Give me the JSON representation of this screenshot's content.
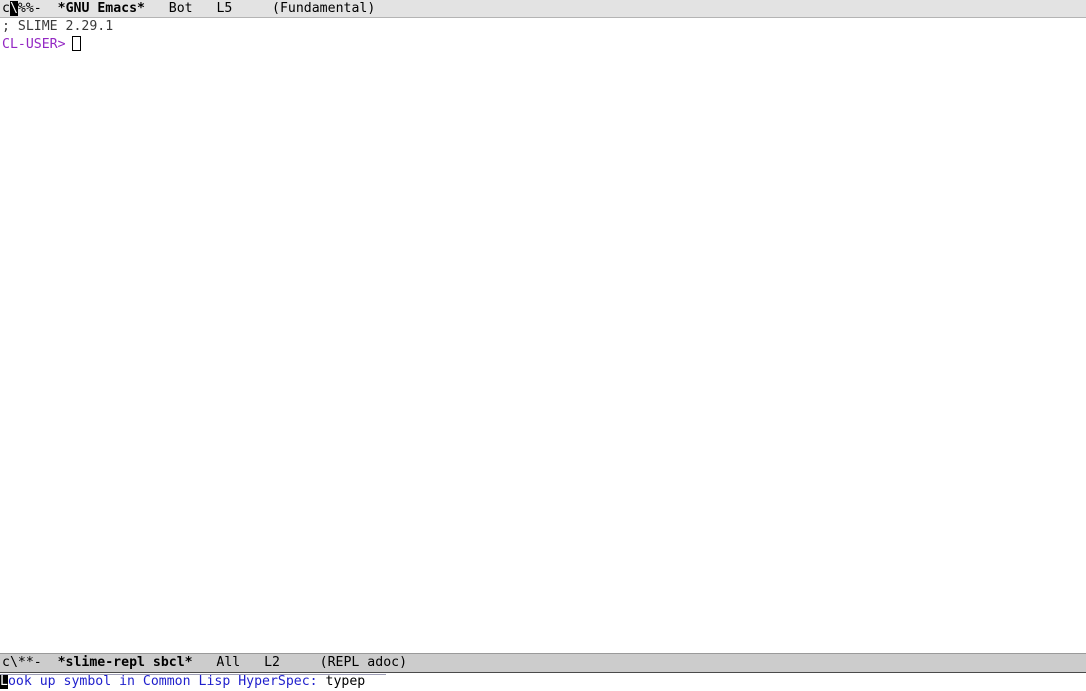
{
  "window": {
    "title": "GNU Emacs"
  },
  "top_window": {
    "mode_line": {
      "prefix_head": "c",
      "prefix_cursor_char": "\\",
      "prefix_tail": "%%-",
      "buffer_name": "*GNU Emacs*",
      "position_indicator": "Bot",
      "line_number": "L5",
      "major_mode": "(Fundamental)"
    },
    "lines": [
      {
        "id": "slime-banner",
        "text": "; SLIME 2.29.1"
      },
      {
        "id": "repl-prompt",
        "prompt": "CL-USER>",
        "input": ""
      }
    ]
  },
  "bottom_window": {
    "mode_line": {
      "prefix_head": "c",
      "prefix_cursor_char": "",
      "prefix_tail": "\\**-",
      "buffer_name": "*slime-repl sbcl*",
      "position_indicator": "All",
      "line_number": "L2",
      "major_mode": "(REPL adoc)"
    }
  },
  "minibuffer": {
    "cursor_char": "L",
    "prompt_rest": "ook up symbol in Common Lisp HyperSpec: ",
    "input_value": "typep"
  },
  "colors": {
    "background": "#ffffff",
    "foreground": "#000000",
    "mode_line_inactive_bg": "#e3e3e3",
    "mode_line_active_bg": "#cccccc",
    "repl_prompt_fg": "#9327c3",
    "minibuffer_prompt_fg": "#1f1fcc",
    "comment_fg": "#3a3a3a",
    "cursor": "#000000"
  }
}
